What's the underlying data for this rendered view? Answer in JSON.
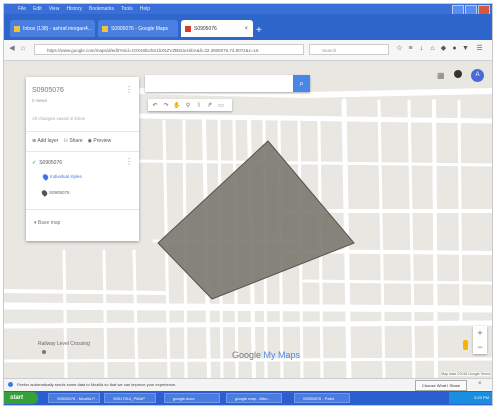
{
  "window": {
    "menu": [
      "File",
      "Edit",
      "View",
      "History",
      "Bookmarks",
      "Tools",
      "Help"
    ]
  },
  "tabs": [
    {
      "label": "Inbox (138) - ashraf.morgan4...",
      "active": false
    },
    {
      "label": "S0905076 - Google Maps",
      "active": false
    },
    {
      "label": "S0905076",
      "active": true
    }
  ],
  "address_bar": {
    "url": "https://www.google.com/maps/d/edit?mid=zOXs8bUhS1bX5ZVZB8Ue1kbA&ll=32.3905076,74.8072&z=16",
    "search_placeholder": "Search"
  },
  "map_panel": {
    "title": "S0905076",
    "views": "0 views",
    "edit_note": "All changes saved in Drive",
    "actions": [
      "Add layer",
      "Share",
      "Preview"
    ],
    "layer_name": "S0905076",
    "layer_style": "Individual styles",
    "layer_item": "S0905076",
    "base_map": "Base map"
  },
  "map": {
    "landmark": "Railway Level Crossing",
    "logo_google": "Google",
    "logo_suffix": "My Maps",
    "attribution": "Map data ©2018 Google  Terms",
    "polygon_fill": "#7d7b72",
    "road_color": "#ffffff",
    "background_color": "#e9e7e2"
  },
  "info_bar": {
    "text": "Firefox automatically sends some data to Mozilla so that we can improve your experience.",
    "button": "Choose What I Share"
  },
  "taskbar": {
    "start": "start",
    "items": [
      "S0905076 - Mozilla F...",
      "S0917014_PMAP",
      "google.docx",
      "google map - Micr...",
      "S0905076 - Paint"
    ],
    "clock": "2:20 PM"
  },
  "colors": {
    "titlebar": "#3a6fd8",
    "accent_blue": "#4a86e8",
    "taskbar": "#2b5fd0",
    "start_green": "#36a03a"
  }
}
